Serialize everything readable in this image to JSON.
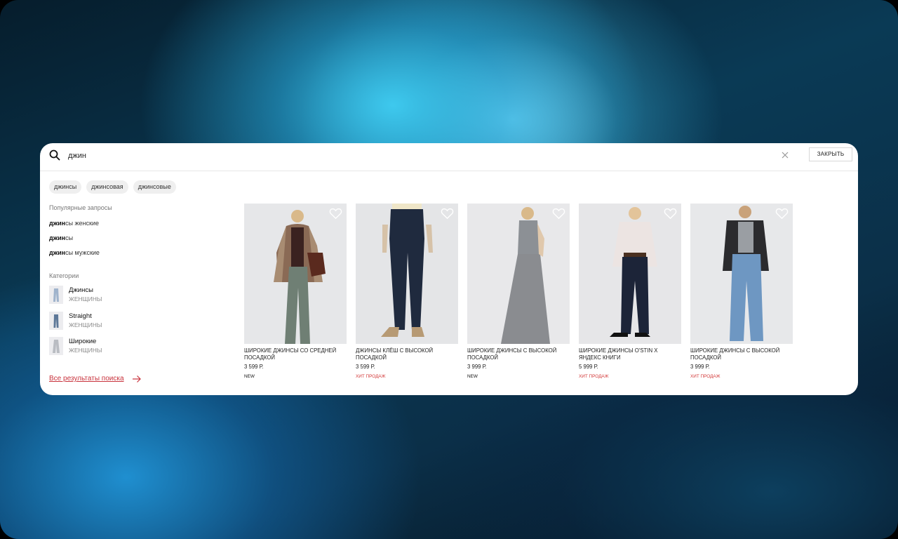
{
  "search": {
    "value": "джин",
    "close_label": "ЗАКРЫТЬ"
  },
  "suggestions": [
    "джинсы",
    "джинсовая",
    "джинсовые"
  ],
  "popular": {
    "title": "Популярные запросы",
    "items": [
      {
        "match": "джин",
        "rest": "сы женские"
      },
      {
        "match": "джин",
        "rest": "сы"
      },
      {
        "match": "джин",
        "rest": "сы мужские"
      }
    ]
  },
  "categories": {
    "title": "Категории",
    "items": [
      {
        "name": "Джинсы",
        "sub": "ЖЕНЩИНЫ"
      },
      {
        "name": "Straight",
        "sub": "ЖЕНЩИНЫ"
      },
      {
        "name": "Широкие",
        "sub": "ЖЕНЩИНЫ"
      }
    ]
  },
  "all_results": "Все результаты поиска",
  "products": [
    {
      "name": "Широкие джинсы со средней посадкой",
      "price": "3 599 Р.",
      "badge": "NEW",
      "badge_hit": false
    },
    {
      "name": "Джинсы клёш с высокой посадкой",
      "price": "3 599 Р.",
      "badge": "ХИТ ПРОДАЖ",
      "badge_hit": true
    },
    {
      "name": "Широкие джинсы с высокой посадкой",
      "price": "3 999 Р.",
      "badge": "NEW",
      "badge_hit": false
    },
    {
      "name": "Широкие джинсы O'STIN x Яндекс Книги",
      "price": "5 999 Р.",
      "badge": "ХИТ ПРОДАЖ",
      "badge_hit": true
    },
    {
      "name": "Широкие джинсы с высокой посадкой",
      "price": "3 999 Р.",
      "badge": "ХИТ ПРОДАЖ",
      "badge_hit": true
    }
  ],
  "colors": {
    "accent": "#c8323c",
    "hit_badge": "#d33a3a",
    "chip_bg": "#efefef"
  },
  "icons": [
    "search-icon",
    "clear-icon",
    "heart-icon",
    "arrow-right-icon"
  ]
}
